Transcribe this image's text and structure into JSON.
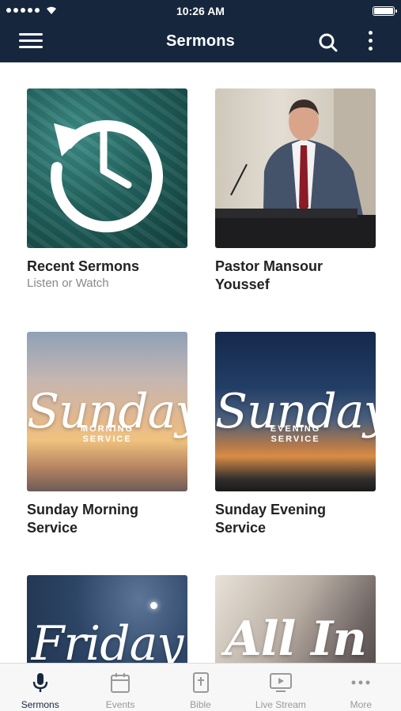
{
  "status_bar": {
    "time": "10:26 AM"
  },
  "header": {
    "title": "Sermons",
    "menu_icon": "hamburger-icon",
    "search_icon": "search-icon",
    "more_icon": "vertical-ellipsis-icon"
  },
  "colors": {
    "nav_background": "#16273d",
    "tab_active": "#16273d",
    "tab_inactive": "#999999"
  },
  "cards": [
    {
      "title": "Recent Sermons",
      "subtitle": "Listen or Watch",
      "icon": "history-clock-icon"
    },
    {
      "title": "Pastor Mansour Youssef",
      "subtitle": ""
    },
    {
      "title": "Sunday Morning Service",
      "image_script": "Sunday",
      "image_caption_1": "MORNING",
      "image_caption_2": "SERVICE"
    },
    {
      "title": "Sunday Evening Service",
      "image_script": "Sunday",
      "image_caption_1": "EVENING",
      "image_caption_2": "SERVICE"
    },
    {
      "title": "",
      "image_script": "Friday"
    },
    {
      "title": "",
      "image_script": "All In"
    }
  ],
  "tabs": [
    {
      "label": "Sermons",
      "icon": "microphone-icon",
      "active": true
    },
    {
      "label": "Events",
      "icon": "calendar-icon",
      "active": false
    },
    {
      "label": "Bible",
      "icon": "bible-icon",
      "active": false
    },
    {
      "label": "Live Stream",
      "icon": "tv-play-icon",
      "active": false
    },
    {
      "label": "More",
      "icon": "horizontal-ellipsis-icon",
      "active": false
    }
  ]
}
